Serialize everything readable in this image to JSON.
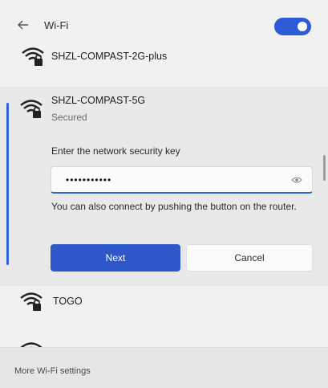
{
  "header": {
    "back_icon": "back-arrow-icon",
    "title": "Wi-Fi",
    "toggle_on": true,
    "accent_color": "#2b5bd7"
  },
  "networks": [
    {
      "name": "SHZL-COMPAST-2G-plus",
      "secured": true
    },
    {
      "name": "SHZL-COMPAST-5G",
      "status": "Secured",
      "secured": true,
      "expanded": true
    },
    {
      "name": "TOGO",
      "secured": true
    },
    {
      "name": "",
      "secured": true
    }
  ],
  "connect_form": {
    "label": "Enter the network security key",
    "password_value": "•••••••••••",
    "helper_text": "You can also connect by pushing the button on the router.",
    "next_label": "Next",
    "cancel_label": "Cancel"
  },
  "footer": {
    "link": "More Wi-Fi settings"
  }
}
